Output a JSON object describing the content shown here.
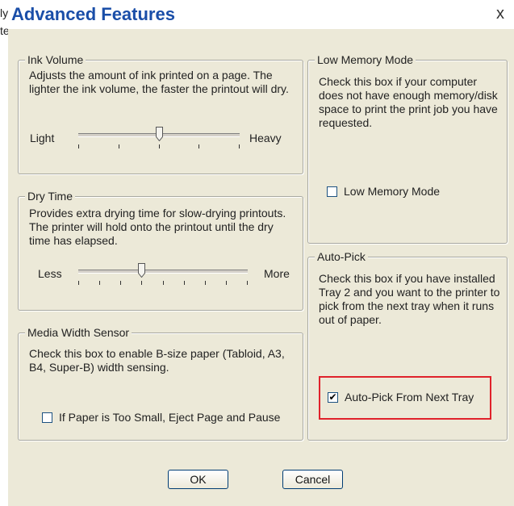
{
  "background": {
    "fragment1": "ly",
    "fragment2": "te"
  },
  "window": {
    "title": "Advanced Features",
    "close_glyph": "x"
  },
  "ink_volume": {
    "label": "Ink Volume",
    "description_line1": "Adjusts the amount of ink printed on a page. The",
    "description_line2": "lighter the ink volume, the faster the printout will dry.",
    "min_label": "Light",
    "max_label": "Heavy",
    "tick_count": 5,
    "value_index": 2
  },
  "dry_time": {
    "label": "Dry Time",
    "description_line1": "Provides extra drying time for slow-drying printouts.",
    "description_line2": "The printer will hold onto the printout until the dry",
    "description_line3": "time has elapsed.",
    "min_label": "Less",
    "max_label": "More",
    "tick_count": 9,
    "value_index": 3
  },
  "media_width": {
    "label": "Media Width Sensor",
    "description_line1": "Check this box to enable B-size paper (Tabloid, A3,",
    "description_line2": "B4, Super-B) width sensing.",
    "checkbox_label": "If Paper is Too Small, Eject Page and Pause",
    "checked": false
  },
  "low_memory": {
    "label": "Low Memory Mode",
    "description_line1": "Check this box if your computer",
    "description_line2": "does not have enough memory/disk",
    "description_line3": "space to print the print job you have",
    "description_line4": "requested.",
    "checkbox_label": "Low Memory Mode",
    "checked": false
  },
  "auto_pick": {
    "label": "Auto-Pick",
    "description_line1": "Check this box if you have installed",
    "description_line2": "Tray 2 and you want to the printer to",
    "description_line3": "pick from the next tray when it runs",
    "description_line4": "out of paper.",
    "checkbox_label": "Auto-Pick From Next Tray",
    "checked": true,
    "check_glyph": "✔"
  },
  "buttons": {
    "ok": "OK",
    "cancel": "Cancel"
  },
  "colors": {
    "title": "#1a4ea8",
    "highlight": "#e0222b",
    "dialog_bg": "#ece9d8"
  }
}
